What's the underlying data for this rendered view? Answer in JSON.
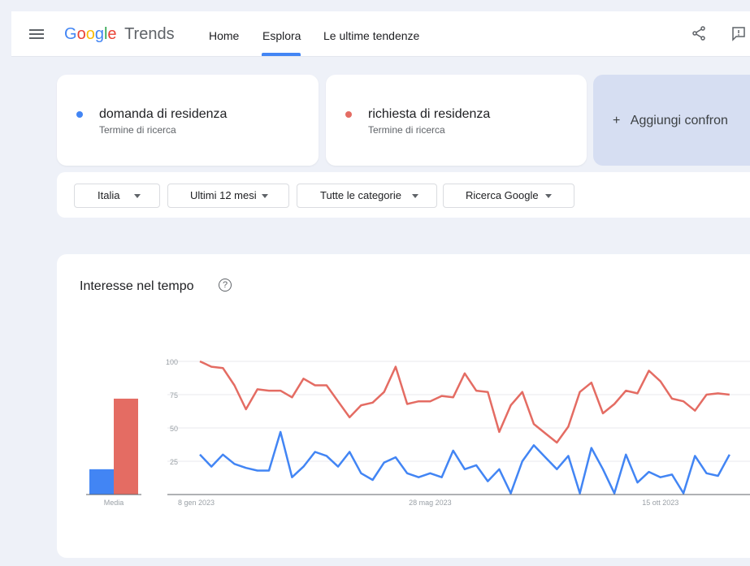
{
  "app": {
    "logo_google": "Google",
    "logo_trends": "Trends"
  },
  "nav": [
    "Home",
    "Esplora",
    "Le ultime tendenze"
  ],
  "terms": [
    {
      "name": "domanda di residenza",
      "subtitle": "Termine di ricerca",
      "color": "#4285f4"
    },
    {
      "name": "richiesta di residenza",
      "subtitle": "Termine di ricerca",
      "color": "#e46c63"
    }
  ],
  "add_compare_label": "+   Aggiungi confron",
  "filters": [
    "Italia",
    "Ultimi 12 mesi",
    "Tutte le categorie",
    "Ricerca Google"
  ],
  "panel": {
    "title": "Interesse nel tempo",
    "help_glyph": "?"
  },
  "chart_data": {
    "type": "line",
    "average_bars": {
      "label": "Media",
      "values": [
        19,
        72
      ]
    },
    "y_ticks": [
      100,
      75,
      50,
      25
    ],
    "ylim": [
      0,
      100
    ],
    "x_tick_labels": [
      "8 gen 2023",
      "28 mag 2023",
      "15 ott 2023"
    ],
    "series": [
      {
        "color": "#e46c63",
        "values": [
          100,
          96,
          95,
          82,
          64,
          79,
          78,
          78,
          73,
          87,
          82,
          82,
          70,
          58,
          67,
          69,
          77,
          96,
          68,
          70,
          70,
          74,
          73,
          91,
          78,
          77,
          47,
          67,
          77,
          53,
          46,
          39,
          51,
          77,
          84,
          61,
          68,
          78,
          76,
          93,
          85,
          72,
          70,
          63,
          75,
          76,
          75
        ]
      },
      {
        "color": "#4285f4",
        "values": [
          30,
          21,
          30,
          23,
          20,
          18,
          18,
          47,
          13,
          21,
          32,
          29,
          21,
          32,
          16,
          11,
          24,
          28,
          16,
          13,
          16,
          13,
          33,
          19,
          22,
          10,
          19,
          1,
          25,
          37,
          28,
          19,
          29,
          1,
          35,
          19,
          1,
          30,
          9,
          17,
          13,
          15,
          1,
          29,
          16,
          14,
          30
        ]
      }
    ]
  }
}
